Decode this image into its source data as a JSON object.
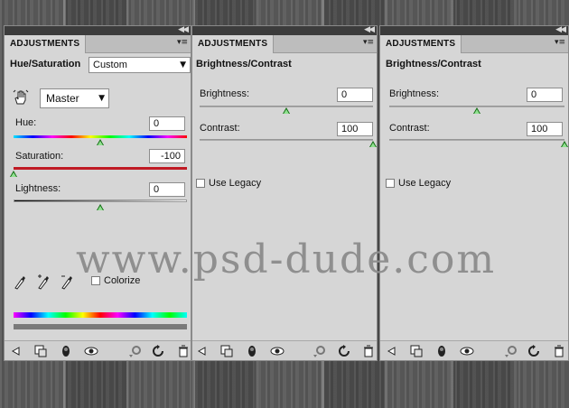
{
  "panels": {
    "hue_saturation": {
      "tab_label": "ADJUSTMENTS",
      "title": "Hue/Saturation",
      "preset": "Custom",
      "channel": "Master",
      "hue_label": "Hue:",
      "hue_value": "0",
      "hue_level": 0.5,
      "saturation_label": "Saturation:",
      "saturation_value": "-100",
      "saturation_level": 0.0,
      "lightness_label": "Lightness:",
      "lightness_value": "0",
      "lightness_level": 0.5,
      "colorize_label": "Colorize"
    },
    "brightness_contrast_1": {
      "tab_label": "ADJUSTMENTS",
      "title": "Brightness/Contrast",
      "brightness_label": "Brightness:",
      "brightness_value": "0",
      "brightness_level": 0.5,
      "contrast_label": "Contrast:",
      "contrast_value": "100",
      "contrast_level": 1.0,
      "legacy_label": "Use Legacy"
    },
    "brightness_contrast_2": {
      "tab_label": "ADJUSTMENTS",
      "title": "Brightness/Contrast",
      "brightness_label": "Brightness:",
      "brightness_value": "0",
      "brightness_level": 0.5,
      "contrast_label": "Contrast:",
      "contrast_value": "100",
      "contrast_level": 1.0,
      "legacy_label": "Use Legacy"
    }
  },
  "watermark": "www.psd-dude.com",
  "icons": {
    "collapse": "double-chevron-left-icon",
    "menu": "panel-menu-icon",
    "hand": "targeted-adjustment-hand-icon",
    "eyedropper": "eyedropper-icon",
    "eyedropper_add": "eyedropper-plus-icon",
    "eyedropper_subtract": "eyedropper-minus-icon",
    "footer": [
      "back-arrow-icon",
      "clip-to-layer-icon",
      "layer-visibility-circle-icon",
      "eye-icon",
      "previous-state-icon",
      "reset-icon",
      "trash-icon"
    ]
  },
  "colors": {
    "panel_bg": "#d6d6d6",
    "slider_thumb": "#0e6a0e",
    "saturation_track": "#c01a24",
    "topbar": "#3c3c3c"
  }
}
